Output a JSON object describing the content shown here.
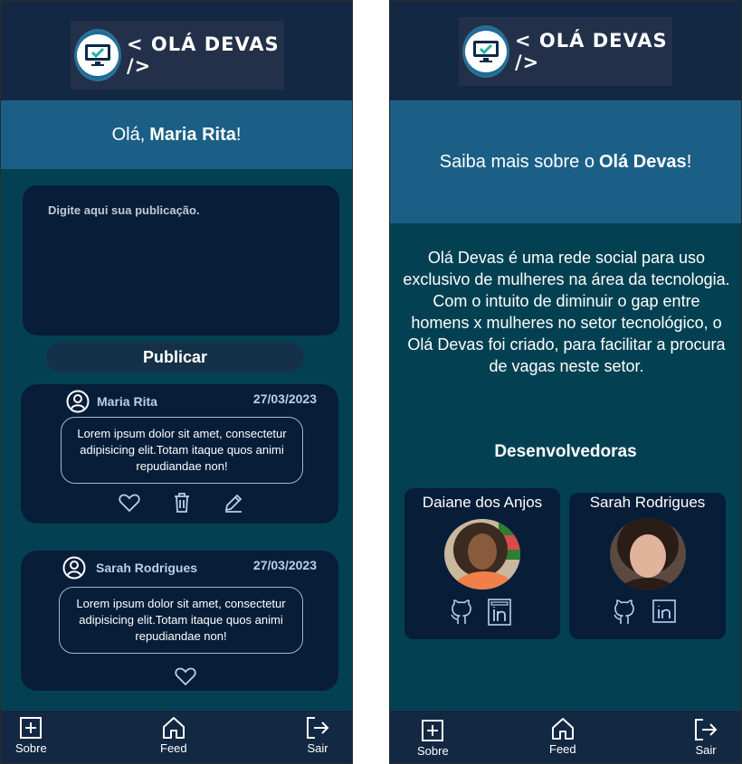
{
  "app": {
    "brand": "< OLÁ DEVAS />"
  },
  "feed_screen": {
    "greeting_prefix": "Olá,",
    "greeting_name": "Maria Rita",
    "greeting_suffix": "!",
    "composer_placeholder": "Digite aqui sua publicação.",
    "publish_label": "Publicar",
    "posts": [
      {
        "author": "Maria Rita",
        "date": "27/03/2023",
        "body": "Lorem ipsum dolor sit amet, consectetur adipisicing elit.Totam itaque quos animi repudiandae non!",
        "actions": [
          "heart-icon",
          "trash-icon",
          "pencil-icon"
        ]
      },
      {
        "author": "Sarah Rodrigues",
        "date": "27/03/2023",
        "body": "Lorem ipsum dolor sit amet, consectetur adipisicing elit.Totam itaque quos animi repudiandae non!",
        "actions": [
          "heart-icon"
        ]
      }
    ]
  },
  "about_screen": {
    "banner_prefix": "Saiba mais sobre o",
    "banner_name": "Olá Devas",
    "banner_suffix": "!",
    "description": "Olá Devas é uma rede social para uso exclusivo de mulheres na área da tecnologia. Com o intuito de diminuir o gap entre homens x mulheres no setor tecnológico, o Olá Devas foi criado, para facilitar a procura de vagas neste setor.",
    "developers_title": "Desenvolvedoras",
    "developers": [
      {
        "name": "Daiane dos Anjos",
        "links": [
          "github-icon",
          "linkedin-icon"
        ]
      },
      {
        "name": "Sarah Rodrigues",
        "links": [
          "github-icon",
          "linkedin-icon"
        ]
      }
    ]
  },
  "bottom_nav": {
    "items": [
      {
        "label": "Sobre",
        "icon": "plus-square-icon"
      },
      {
        "label": "Feed",
        "icon": "home-icon"
      },
      {
        "label": "Sair",
        "icon": "logout-icon"
      }
    ]
  },
  "colors": {
    "background": "#034152",
    "topbar": "#132842",
    "banner": "#1b5f86",
    "card": "#081d38",
    "accent_text": "#b7d0ee"
  }
}
